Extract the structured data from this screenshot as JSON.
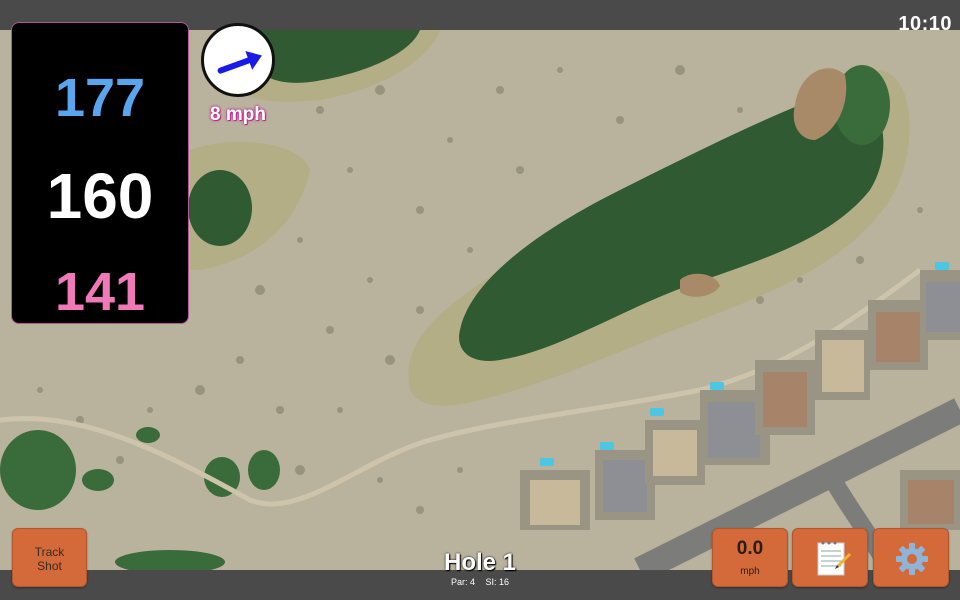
{
  "status": {
    "clock": "10:10"
  },
  "distances": {
    "back": "177",
    "middle": "160",
    "front": "141"
  },
  "wind": {
    "speed": "8 mph",
    "icon": "wind-direction-arrow-icon",
    "arrow_color": "#1a1ae6"
  },
  "hole": {
    "title": "Hole 1",
    "par": "Par: 4",
    "stroke_index": "SI: 16"
  },
  "buttons": {
    "track_shot_line1": "Track",
    "track_shot_line2": "Shot",
    "speed_value": "0.0",
    "speed_unit": "mph",
    "notes_icon": "notepad-icon",
    "settings_icon": "gear-icon"
  },
  "colors": {
    "back": "#5aa6ee",
    "middle": "#ffffff",
    "front": "#f07ab8",
    "button": "#d46a3a",
    "bar": "#4a4a4a"
  }
}
